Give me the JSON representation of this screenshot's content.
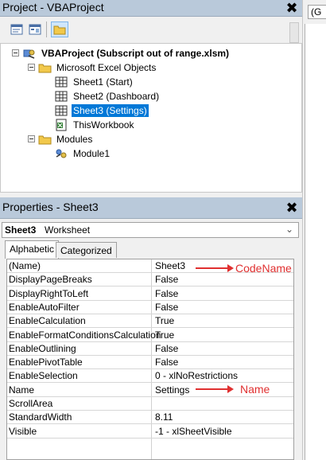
{
  "project_window": {
    "title": "Project - VBAProject",
    "close_label": "✖"
  },
  "toolbar": {
    "buttons": [
      {
        "name": "view-code",
        "icon": "view-code-icon"
      },
      {
        "name": "view-object",
        "icon": "view-object-icon"
      },
      {
        "name": "toggle-folders",
        "icon": "folder-icon",
        "active": true
      }
    ]
  },
  "tree": {
    "project": "VBAProject (Subscript out of range.xlsm)",
    "excel_objects_folder": "Microsoft Excel Objects",
    "sheets": [
      "Sheet1 (Start)",
      "Sheet2 (Dashboard)",
      "Sheet3 (Settings)"
    ],
    "workbook": "ThisWorkbook",
    "modules_folder": "Modules",
    "modules": [
      "Module1"
    ],
    "selected": "Sheet3 (Settings)"
  },
  "properties_window": {
    "title": "Properties - Sheet3",
    "close_label": "✖",
    "object_name": "Sheet3",
    "object_type": "Worksheet",
    "tabs": [
      "Alphabetic",
      "Categorized"
    ],
    "active_tab": "Alphabetic",
    "rows": [
      {
        "name": "(Name)",
        "value": "Sheet3"
      },
      {
        "name": "DisplayPageBreaks",
        "value": "False"
      },
      {
        "name": "DisplayRightToLeft",
        "value": "False"
      },
      {
        "name": "EnableAutoFilter",
        "value": "False"
      },
      {
        "name": "EnableCalculation",
        "value": "True"
      },
      {
        "name": "EnableFormatConditionsCalculation",
        "value": "True"
      },
      {
        "name": "EnableOutlining",
        "value": "False"
      },
      {
        "name": "EnablePivotTable",
        "value": "False"
      },
      {
        "name": "EnableSelection",
        "value": "0 - xlNoRestrictions"
      },
      {
        "name": "Name",
        "value": "Settings"
      },
      {
        "name": "ScrollArea",
        "value": ""
      },
      {
        "name": "StandardWidth",
        "value": "8.11"
      },
      {
        "name": "Visible",
        "value": "-1 - xlSheetVisible"
      }
    ]
  },
  "annotations": {
    "codename": "CodeName",
    "name": "Name",
    "color": "#e03030"
  },
  "code_window": {
    "combo_text": "(G"
  },
  "colors": {
    "titlebar": "#b9c9da",
    "selection": "#0078d7"
  }
}
